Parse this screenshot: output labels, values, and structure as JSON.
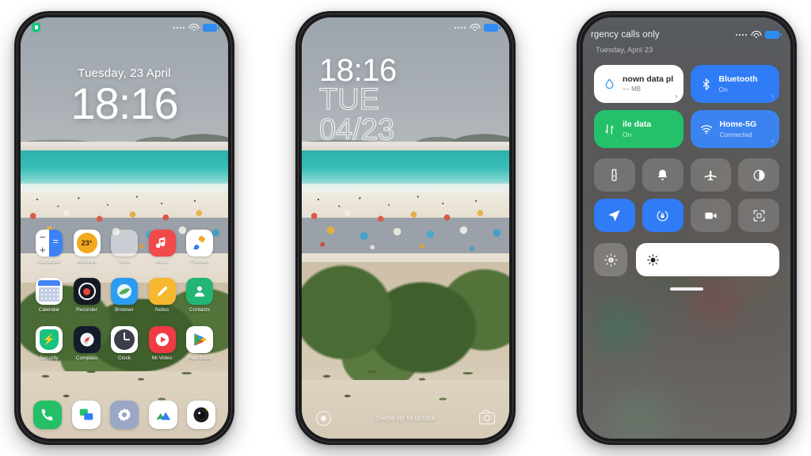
{
  "phone1": {
    "name": "lock-screen-classic",
    "statusbar": {
      "security_icon": "shield-icon",
      "signal_icon": "signal-dots-icon",
      "wifi_icon": "wifi-icon",
      "battery_icon": "battery-icon"
    },
    "lock": {
      "date": "Tuesday, 23 April",
      "time": "18:16"
    },
    "apps": [
      [
        {
          "label": "Calculator",
          "icon": "calculator-icon",
          "minus": "−",
          "plus": "+",
          "equals": "="
        },
        {
          "label": "Weather",
          "icon": "weather-icon",
          "temp": "23°"
        },
        {
          "label": "Tools",
          "icon": "tools-folder-icon"
        },
        {
          "label": "Music",
          "icon": "music-icon"
        },
        {
          "label": "Themes",
          "icon": "themes-icon"
        }
      ],
      [
        {
          "label": "Calendar",
          "icon": "calendar-icon"
        },
        {
          "label": "Recorder",
          "icon": "recorder-icon"
        },
        {
          "label": "Browser",
          "icon": "browser-icon"
        },
        {
          "label": "Notes",
          "icon": "notes-icon"
        },
        {
          "label": "Contacts",
          "icon": "contacts-icon"
        }
      ],
      [
        {
          "label": "Security",
          "icon": "security-icon"
        },
        {
          "label": "Compass",
          "icon": "compass-icon"
        },
        {
          "label": "Clock",
          "icon": "clock-icon"
        },
        {
          "label": "Mi Video",
          "icon": "video-icon"
        },
        {
          "label": "Play Store",
          "icon": "play-store-icon"
        }
      ]
    ],
    "dock": [
      {
        "label": "Phone",
        "icon": "phone-icon"
      },
      {
        "label": "Messages",
        "icon": "messages-icon"
      },
      {
        "label": "Settings",
        "icon": "settings-gear-icon"
      },
      {
        "label": "Gallery",
        "icon": "gallery-icon"
      },
      {
        "label": "Camera",
        "icon": "camera-icon"
      }
    ]
  },
  "phone2": {
    "name": "lock-screen-stylized",
    "lock": {
      "time": "18:16",
      "weekday": "TUE",
      "date": "04/23"
    },
    "footer": {
      "hint": "Swipe up to unlock",
      "left_icon": "flashlight-ring-icon",
      "right_icon": "camera-icon"
    }
  },
  "phone3": {
    "name": "control-center",
    "header": {
      "carrier": "rgency calls only",
      "date": "Tuesday, April 23"
    },
    "cards": [
      {
        "title": "nown data pl",
        "subtitle": "–– MB",
        "icon": "water-drop-icon",
        "state": "inactive",
        "chevron": "›"
      },
      {
        "title": "Bluetooth",
        "subtitle": "On",
        "icon": "bluetooth-icon",
        "state": "active",
        "chevron": "›"
      },
      {
        "title": "ile data",
        "subtitle": "On",
        "icon": "mobile-data-icon",
        "state": "active-green",
        "chevron": ""
      },
      {
        "title": "Home-5G",
        "subtitle": "Connected",
        "icon": "wifi-icon",
        "state": "active",
        "chevron": "›"
      }
    ],
    "toggles": [
      {
        "name": "flashlight-toggle",
        "icon": "flashlight-icon",
        "on": false
      },
      {
        "name": "ringer-toggle",
        "icon": "bell-icon",
        "on": false
      },
      {
        "name": "airplane-mode-toggle",
        "icon": "airplane-icon",
        "on": false
      },
      {
        "name": "dark-mode-toggle",
        "icon": "contrast-icon",
        "on": false
      },
      {
        "name": "location-toggle",
        "icon": "location-arrow-icon",
        "on": true
      },
      {
        "name": "rotation-lock-toggle",
        "icon": "rotation-lock-icon",
        "on": true
      },
      {
        "name": "screen-recorder-toggle",
        "icon": "video-camera-icon",
        "on": false
      },
      {
        "name": "scan-toggle",
        "icon": "scan-frame-icon",
        "on": false
      }
    ],
    "brightness": {
      "auto_icon": "auto-brightness-icon",
      "slider_icon": "sun-icon",
      "level_percent": 100
    }
  },
  "colors": {
    "accent_blue": "#2f7cf6",
    "accent_green": "#25c06a",
    "card_white": "#ffffff",
    "page_bg": "#ffffff"
  }
}
